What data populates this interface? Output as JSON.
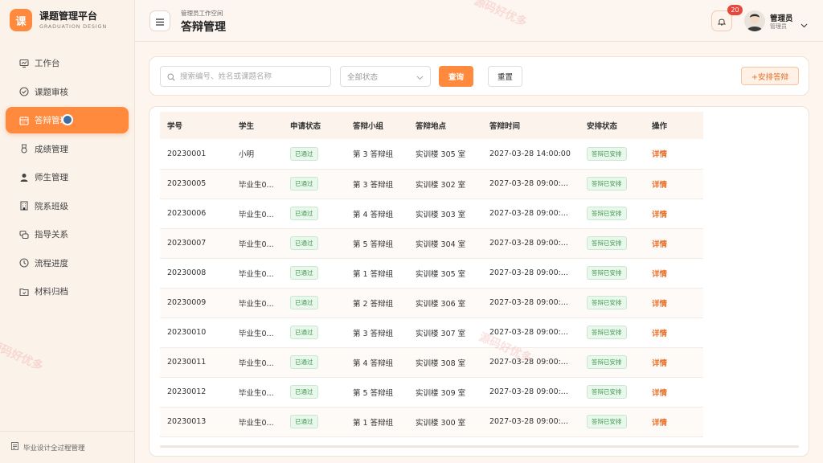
{
  "brand": {
    "logo_char": "课",
    "title": "课题管理平台",
    "subtitle": "GRADUATION DESIGN"
  },
  "sidebar": {
    "items": [
      {
        "label": "工作台",
        "icon": "dashboard-icon"
      },
      {
        "label": "课题审核",
        "icon": "check-circle-icon"
      },
      {
        "label": "答辩管理",
        "icon": "calendar-icon",
        "active": true
      },
      {
        "label": "成绩管理",
        "icon": "medal-icon"
      },
      {
        "label": "师生管理",
        "icon": "user-icon"
      },
      {
        "label": "院系班级",
        "icon": "building-icon"
      },
      {
        "label": "指导关系",
        "icon": "chat-icon"
      },
      {
        "label": "流程进度",
        "icon": "clock-icon"
      },
      {
        "label": "材料归档",
        "icon": "folder-icon"
      }
    ],
    "footer": "毕业设计全过程管理"
  },
  "header": {
    "breadcrumb": "管理员工作空间",
    "title": "答辩管理",
    "notification_count": "20",
    "user_name": "管理员",
    "user_role": "管理员"
  },
  "filter": {
    "search_placeholder": "搜索编号、姓名或课题名称",
    "status_placeholder": "全部状态",
    "query_label": "查询",
    "reset_label": "重置",
    "arrange_label": "+安排答辩"
  },
  "table": {
    "columns": [
      "学号",
      "学生",
      "申请状态",
      "答辩小组",
      "答辩地点",
      "答辩时间",
      "安排状态",
      "操作"
    ],
    "rows": [
      {
        "id": "20230001",
        "student": "小明",
        "apply": "已通过",
        "group": "第 3 答辩组",
        "place": "实训楼 305 室",
        "time": "2027-03-28 14:00:00",
        "arrange": "答辩已安排",
        "action": "详情"
      },
      {
        "id": "20230005",
        "student": "毕业生0...",
        "apply": "已通过",
        "group": "第 3 答辩组",
        "place": "实训楼 302 室",
        "time": "2027-03-28 09:00:...",
        "arrange": "答辩已安排",
        "action": "详情"
      },
      {
        "id": "20230006",
        "student": "毕业生0...",
        "apply": "已通过",
        "group": "第 4 答辩组",
        "place": "实训楼 303 室",
        "time": "2027-03-28 09:00:...",
        "arrange": "答辩已安排",
        "action": "详情"
      },
      {
        "id": "20230007",
        "student": "毕业生0...",
        "apply": "已通过",
        "group": "第 5 答辩组",
        "place": "实训楼 304 室",
        "time": "2027-03-28 09:00:...",
        "arrange": "答辩已安排",
        "action": "详情"
      },
      {
        "id": "20230008",
        "student": "毕业生0...",
        "apply": "已通过",
        "group": "第 1 答辩组",
        "place": "实训楼 305 室",
        "time": "2027-03-28 09:00:...",
        "arrange": "答辩已安排",
        "action": "详情"
      },
      {
        "id": "20230009",
        "student": "毕业生0...",
        "apply": "已通过",
        "group": "第 2 答辩组",
        "place": "实训楼 306 室",
        "time": "2027-03-28 09:00:...",
        "arrange": "答辩已安排",
        "action": "详情"
      },
      {
        "id": "20230010",
        "student": "毕业生0...",
        "apply": "已通过",
        "group": "第 3 答辩组",
        "place": "实训楼 307 室",
        "time": "2027-03-28 09:00:...",
        "arrange": "答辩已安排",
        "action": "详情"
      },
      {
        "id": "20230011",
        "student": "毕业生0...",
        "apply": "已通过",
        "group": "第 4 答辩组",
        "place": "实训楼 308 室",
        "time": "2027-03-28 09:00:...",
        "arrange": "答辩已安排",
        "action": "详情"
      },
      {
        "id": "20230012",
        "student": "毕业生0...",
        "apply": "已通过",
        "group": "第 5 答辩组",
        "place": "实训楼 309 室",
        "time": "2027-03-28 09:00:...",
        "arrange": "答辩已安排",
        "action": "详情"
      },
      {
        "id": "20230013",
        "student": "毕业生0...",
        "apply": "已通过",
        "group": "第 1 答辩组",
        "place": "实训楼 300 室",
        "time": "2027-03-28 09:00:...",
        "arrange": "答辩已安排",
        "action": "详情"
      }
    ]
  },
  "watermark": "源码好优多",
  "colors": {
    "accent": "#ff8a3d",
    "success": "#3d9a4d",
    "danger": "#e8473b"
  }
}
